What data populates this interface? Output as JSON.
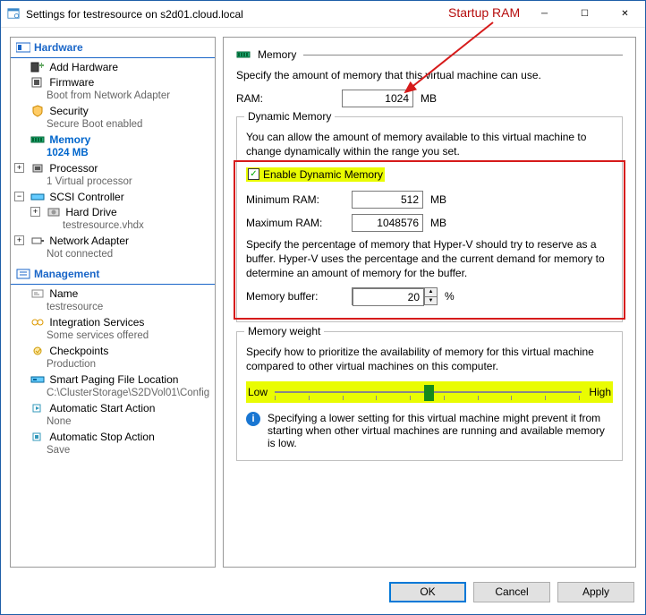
{
  "window": {
    "title": "Settings for testresource on s2d01.cloud.local"
  },
  "annotation": {
    "startup_ram": "Startup RAM"
  },
  "sidebar": {
    "hardware_header": "Hardware",
    "management_header": "Management",
    "items": {
      "add_hw": "Add Hardware",
      "firmware": "Firmware",
      "firmware_sub": "Boot from Network Adapter",
      "security": "Security",
      "security_sub": "Secure Boot enabled",
      "memory": "Memory",
      "memory_sub": "1024 MB",
      "processor": "Processor",
      "processor_sub": "1 Virtual processor",
      "scsi": "SCSI Controller",
      "hdd": "Hard Drive",
      "hdd_sub": "testresource.vhdx",
      "netadapter": "Network Adapter",
      "netadapter_sub": "Not connected",
      "name": "Name",
      "name_sub": "testresource",
      "integ": "Integration Services",
      "integ_sub": "Some services offered",
      "checkpoints": "Checkpoints",
      "checkpoints_sub": "Production",
      "paging": "Smart Paging File Location",
      "paging_sub": "C:\\ClusterStorage\\S2DVol01\\Config",
      "autostart": "Automatic Start Action",
      "autostart_sub": "None",
      "autostop": "Automatic Stop Action",
      "autostop_sub": "Save"
    }
  },
  "content": {
    "header": "Memory",
    "intro": "Specify the amount of memory that this virtual machine can use.",
    "ram_label": "RAM:",
    "ram_value": "1024",
    "ram_unit": "MB",
    "dynmem": {
      "legend": "Dynamic Memory",
      "desc": "You can allow the amount of memory available to this virtual machine to change dynamically within the range you set.",
      "enable_label": "Enable Dynamic Memory",
      "enable_checked": true,
      "min_label": "Minimum RAM:",
      "min_value": "512",
      "min_unit": "MB",
      "max_label": "Maximum RAM:",
      "max_value": "1048576",
      "max_unit": "MB",
      "buffer_desc": "Specify the percentage of memory that Hyper-V should try to reserve as a buffer. Hyper-V uses the percentage and the current demand for memory to determine an amount of memory for the buffer.",
      "buffer_label": "Memory buffer:",
      "buffer_value": "20",
      "buffer_unit": "%"
    },
    "weight": {
      "legend": "Memory weight",
      "desc": "Specify how to prioritize the availability of memory for this virtual machine compared to other virtual machines on this computer.",
      "low": "Low",
      "high": "High",
      "info": "Specifying a lower setting for this virtual machine might prevent it from starting when other virtual machines are running and available memory is low."
    }
  },
  "footer": {
    "ok": "OK",
    "cancel": "Cancel",
    "apply": "Apply"
  }
}
